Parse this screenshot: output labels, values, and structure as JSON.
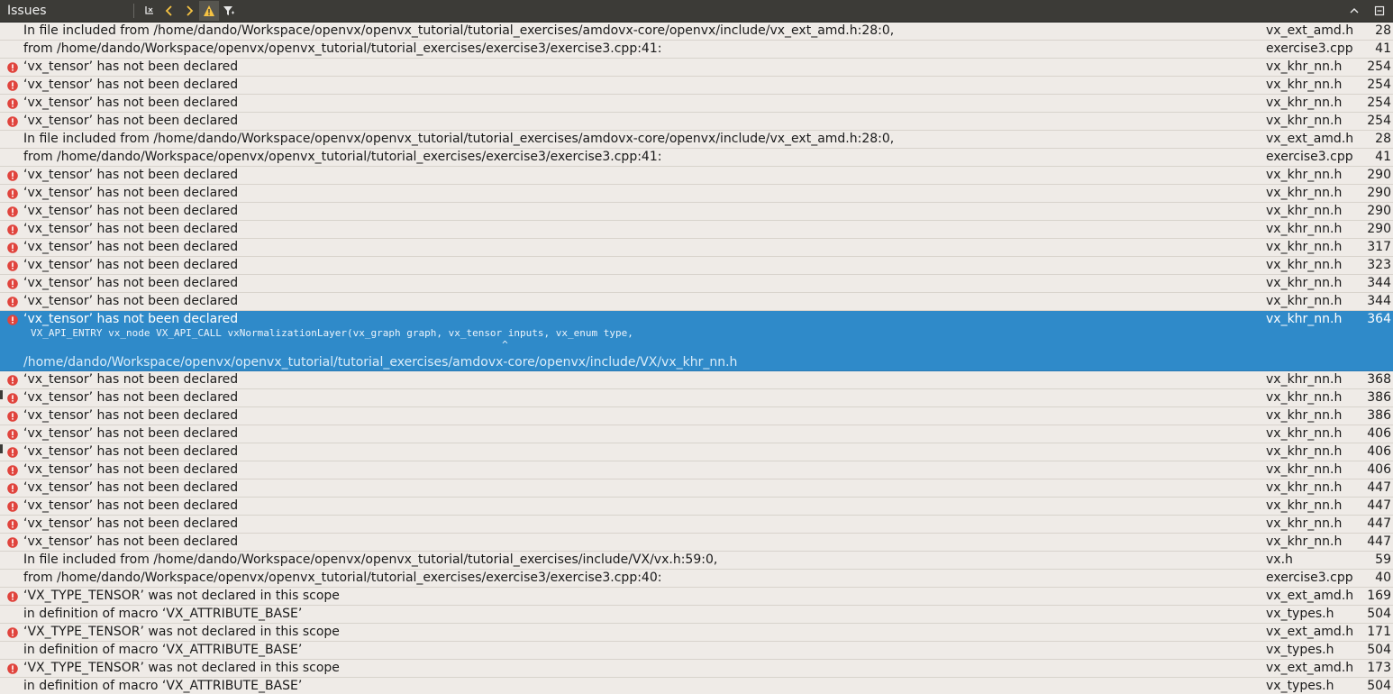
{
  "panel": {
    "title": "Issues",
    "toolbar_icons": [
      "clear-icon",
      "previous-icon",
      "next-icon",
      "warning-filter-icon",
      "filter-icon"
    ],
    "right_icons": [
      "collapse-up-icon",
      "maximize-icon"
    ]
  },
  "colors": {
    "error": "#e0443d",
    "selected_bg": "#2f8ac9",
    "toolbar_bg": "#3c3b37",
    "warning": "#f6c343"
  },
  "rows": [
    {
      "icon": "",
      "msg": "In file included from /home/dando/Workspace/openvx/openvx_tutorial/tutorial_exercises/amdovx-core/openvx/include/vx_ext_amd.h:28:0,",
      "file": "vx_ext_amd.h",
      "line": "28"
    },
    {
      "icon": "",
      "msg": "from /home/dando/Workspace/openvx/openvx_tutorial/tutorial_exercises/exercise3/exercise3.cpp:41:",
      "file": "exercise3.cpp",
      "line": "41"
    },
    {
      "icon": "error",
      "msg": "‘vx_tensor’ has not been declared",
      "file": "vx_khr_nn.h",
      "line": "254"
    },
    {
      "icon": "error",
      "msg": "‘vx_tensor’ has not been declared",
      "file": "vx_khr_nn.h",
      "line": "254"
    },
    {
      "icon": "error",
      "msg": "‘vx_tensor’ has not been declared",
      "file": "vx_khr_nn.h",
      "line": "254"
    },
    {
      "icon": "error",
      "msg": "‘vx_tensor’ has not been declared",
      "file": "vx_khr_nn.h",
      "line": "254"
    },
    {
      "icon": "",
      "msg": "In file included from /home/dando/Workspace/openvx/openvx_tutorial/tutorial_exercises/amdovx-core/openvx/include/vx_ext_amd.h:28:0,",
      "file": "vx_ext_amd.h",
      "line": "28"
    },
    {
      "icon": "",
      "msg": "from /home/dando/Workspace/openvx/openvx_tutorial/tutorial_exercises/exercise3/exercise3.cpp:41:",
      "file": "exercise3.cpp",
      "line": "41"
    },
    {
      "icon": "error",
      "msg": "‘vx_tensor’ has not been declared",
      "file": "vx_khr_nn.h",
      "line": "290"
    },
    {
      "icon": "error",
      "msg": "‘vx_tensor’ has not been declared",
      "file": "vx_khr_nn.h",
      "line": "290"
    },
    {
      "icon": "error",
      "msg": "‘vx_tensor’ has not been declared",
      "file": "vx_khr_nn.h",
      "line": "290"
    },
    {
      "icon": "error",
      "msg": "‘vx_tensor’ has not been declared",
      "file": "vx_khr_nn.h",
      "line": "290"
    },
    {
      "icon": "error",
      "msg": "‘vx_tensor’ has not been declared",
      "file": "vx_khr_nn.h",
      "line": "317"
    },
    {
      "icon": "error",
      "msg": "‘vx_tensor’ has not been declared",
      "file": "vx_khr_nn.h",
      "line": "323"
    },
    {
      "icon": "error",
      "msg": "‘vx_tensor’ has not been declared",
      "file": "vx_khr_nn.h",
      "line": "344"
    },
    {
      "icon": "error",
      "msg": "‘vx_tensor’ has not been declared",
      "file": "vx_khr_nn.h",
      "line": "344"
    },
    {
      "icon": "error",
      "msg": "‘vx_tensor’ has not been declared",
      "file": "vx_khr_nn.h",
      "line": "364",
      "selected": true,
      "detail": "VX_API_ENTRY vx_node VX_API_CALL vxNormalizationLayer(vx_graph graph, vx_tensor inputs, vx_enum type,\n                                                                               ^",
      "path": "/home/dando/Workspace/openvx/openvx_tutorial/tutorial_exercises/amdovx-core/openvx/include/VX/vx_khr_nn.h"
    },
    {
      "icon": "error",
      "msg": "‘vx_tensor’ has not been declared",
      "file": "vx_khr_nn.h",
      "line": "368"
    },
    {
      "icon": "error",
      "msg": "‘vx_tensor’ has not been declared",
      "file": "vx_khr_nn.h",
      "line": "386"
    },
    {
      "icon": "error",
      "msg": "‘vx_tensor’ has not been declared",
      "file": "vx_khr_nn.h",
      "line": "386"
    },
    {
      "icon": "error",
      "msg": "‘vx_tensor’ has not been declared",
      "file": "vx_khr_nn.h",
      "line": "406"
    },
    {
      "icon": "error",
      "msg": "‘vx_tensor’ has not been declared",
      "file": "vx_khr_nn.h",
      "line": "406"
    },
    {
      "icon": "error",
      "msg": "‘vx_tensor’ has not been declared",
      "file": "vx_khr_nn.h",
      "line": "406"
    },
    {
      "icon": "error",
      "msg": "‘vx_tensor’ has not been declared",
      "file": "vx_khr_nn.h",
      "line": "447"
    },
    {
      "icon": "error",
      "msg": "‘vx_tensor’ has not been declared",
      "file": "vx_khr_nn.h",
      "line": "447"
    },
    {
      "icon": "error",
      "msg": "‘vx_tensor’ has not been declared",
      "file": "vx_khr_nn.h",
      "line": "447"
    },
    {
      "icon": "error",
      "msg": "‘vx_tensor’ has not been declared",
      "file": "vx_khr_nn.h",
      "line": "447"
    },
    {
      "icon": "",
      "msg": "In file included from /home/dando/Workspace/openvx/openvx_tutorial/tutorial_exercises/include/VX/vx.h:59:0,",
      "file": "vx.h",
      "line": "59"
    },
    {
      "icon": "",
      "msg": "from /home/dando/Workspace/openvx/openvx_tutorial/tutorial_exercises/exercise3/exercise3.cpp:40:",
      "file": "exercise3.cpp",
      "line": "40"
    },
    {
      "icon": "error",
      "msg": "‘VX_TYPE_TENSOR’ was not declared in this scope",
      "file": "vx_ext_amd.h",
      "line": "169"
    },
    {
      "icon": "",
      "msg": "in definition of macro ‘VX_ATTRIBUTE_BASE’",
      "file": "vx_types.h",
      "line": "504"
    },
    {
      "icon": "error",
      "msg": "‘VX_TYPE_TENSOR’ was not declared in this scope",
      "file": "vx_ext_amd.h",
      "line": "171"
    },
    {
      "icon": "",
      "msg": "in definition of macro ‘VX_ATTRIBUTE_BASE’",
      "file": "vx_types.h",
      "line": "504"
    },
    {
      "icon": "error",
      "msg": "‘VX_TYPE_TENSOR’ was not declared in this scope",
      "file": "vx_ext_amd.h",
      "line": "173"
    },
    {
      "icon": "",
      "msg": "in definition of macro ‘VX_ATTRIBUTE_BASE’",
      "file": "vx_types.h",
      "line": "504"
    }
  ]
}
